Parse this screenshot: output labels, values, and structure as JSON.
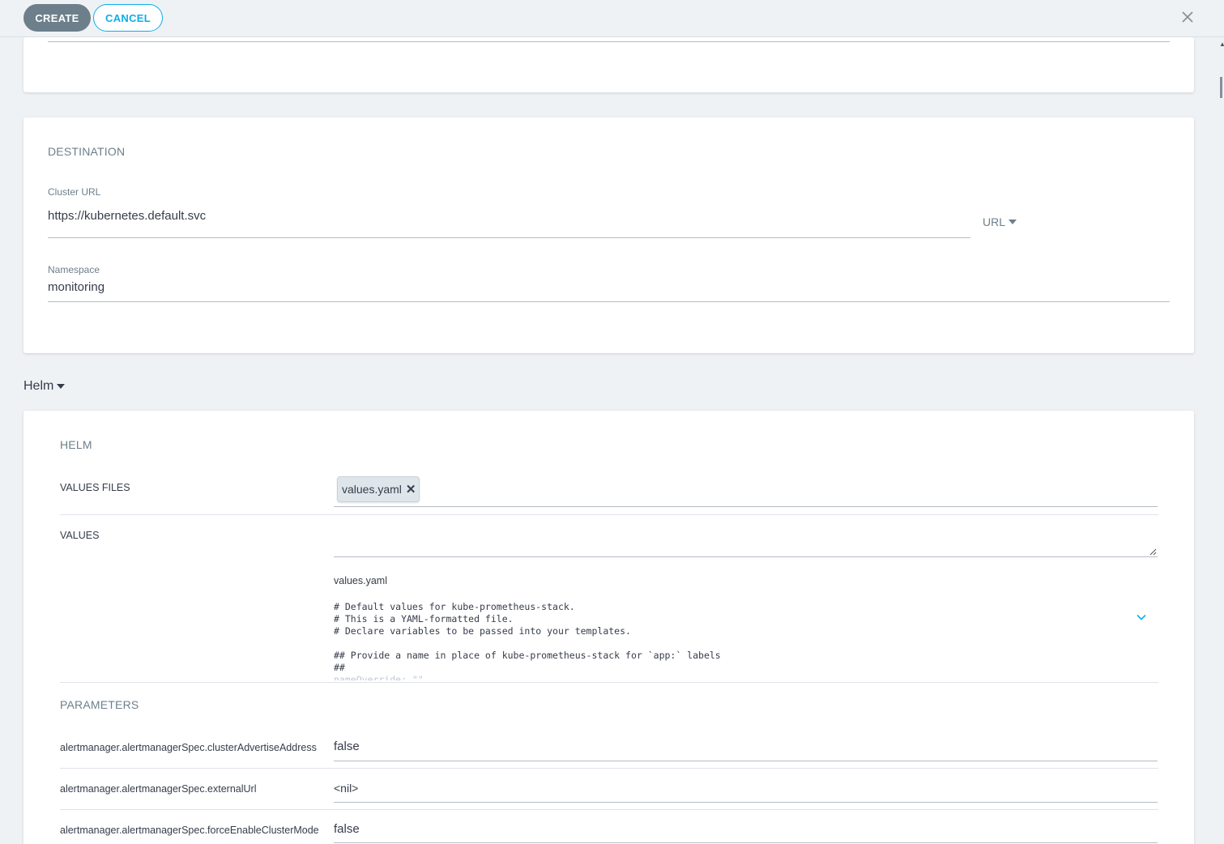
{
  "toolbar": {
    "create_label": "CREATE",
    "cancel_label": "CANCEL"
  },
  "destination": {
    "title": "DESTINATION",
    "cluster_url_label": "Cluster URL",
    "cluster_url_value": "https://kubernetes.default.svc",
    "url_selector": "URL",
    "namespace_label": "Namespace",
    "namespace_value": "monitoring"
  },
  "helm_toggle": "Helm",
  "helm": {
    "title": "HELM",
    "values_files_label": "VALUES FILES",
    "values_files_chip": "values.yaml",
    "values_label": "VALUES",
    "values_file_name": "values.yaml",
    "code_lines": [
      "# Default values for kube-prometheus-stack.",
      "# This is a YAML-formatted file.",
      "# Declare variables to be passed into your templates.",
      "",
      "## Provide a name in place of kube-prometheus-stack for `app:` labels",
      "##",
      "nameOverride: \"\""
    ]
  },
  "parameters": {
    "title": "PARAMETERS",
    "rows": [
      {
        "name": "alertmanager.alertmanagerSpec.clusterAdvertiseAddress",
        "value": "false"
      },
      {
        "name": "alertmanager.alertmanagerSpec.externalUrl",
        "value": "<nil>"
      },
      {
        "name": "alertmanager.alertmanagerSpec.forceEnableClusterMode",
        "value": "false"
      }
    ]
  },
  "icons": {
    "close": "close-icon",
    "caret": "caret-down-icon",
    "remove": "remove-chip-icon",
    "expand": "chevron-down-icon"
  },
  "colors": {
    "accent": "#0dadea",
    "create_button": "#6d7f8b",
    "background": "#eff2f5",
    "panel": "#ffffff"
  }
}
